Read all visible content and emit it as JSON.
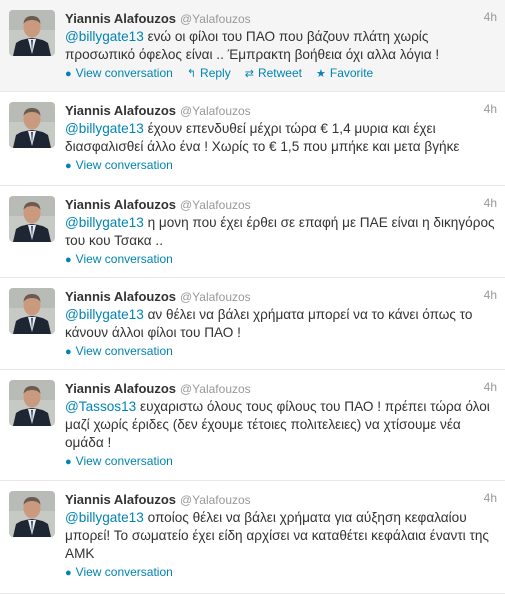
{
  "tweets": [
    {
      "name": "Yiannis Alafouzos",
      "handle": "@Yalafouzos",
      "time": "4h",
      "mention": "@billygate13",
      "text": " ενώ οι φίλοι του ΠΑΟ που βάζουν πλάτη χωρίς προσωπικό όφελος είναι .. Έμπρακτη βοήθεια όχι αλλα λόγια !",
      "view_label": "View conversation",
      "reply_label": "Reply",
      "retweet_label": "Retweet",
      "favorite_label": "Favorite"
    },
    {
      "name": "Yiannis Alafouzos",
      "handle": "@Yalafouzos",
      "time": "4h",
      "mention": "@billygate13",
      "text": " έχουν επενδυθεί μέχρι τώρα € 1,4 μυρια και έχει διασφαλισθεί άλλο ένα ! Χωρίς το € 1,5 που μπήκε και μετα βγήκε",
      "view_label": "View conversation"
    },
    {
      "name": "Yiannis Alafouzos",
      "handle": "@Yalafouzos",
      "time": "4h",
      "mention": "@billygate13",
      "text": " η μονη που έχει έρθει σε επαφή με ΠΑΕ είναι η δικηγόρος του κου Τσακα ..",
      "view_label": "View conversation"
    },
    {
      "name": "Yiannis Alafouzos",
      "handle": "@Yalafouzos",
      "time": "4h",
      "mention": "@billygate13",
      "text": " αν θέλει να βάλει χρήματα μπορεί να το κάνει όπως το κάνουν άλλοι φίλοι του ΠΑΟ !",
      "view_label": "View conversation"
    },
    {
      "name": "Yiannis Alafouzos",
      "handle": "@Yalafouzos",
      "time": "4h",
      "mention": "@Tassos13",
      "text": " ευχαριστω όλους τους φίλους του ΠΑΟ ! πρέπει τώρα όλοι μαζί χωρίς έριδες (δεν έχουμε τέτοιες πολιτελειες) να χτίσουμε νέα ομάδα !",
      "view_label": "View conversation"
    },
    {
      "name": "Yiannis Alafouzos",
      "handle": "@Yalafouzos",
      "time": "4h",
      "mention": "@billygate13",
      "text": " οποίος θέλει να βάλει χρήματα για αύξηση κεφαλαίου μπορεί! Το σωματείο έχει είδη αρχίσει να καταθέτει κεφάλαια έναντι της ΑΜΚ",
      "view_label": "View conversation"
    }
  ],
  "colors": {
    "link": "#0084b4",
    "muted": "#999999",
    "hover_bg": "#f5f5f5"
  },
  "icons": {
    "view": "speech-bubble-icon",
    "reply": "reply-arrow-icon",
    "retweet": "retweet-icon",
    "favorite": "star-icon"
  }
}
